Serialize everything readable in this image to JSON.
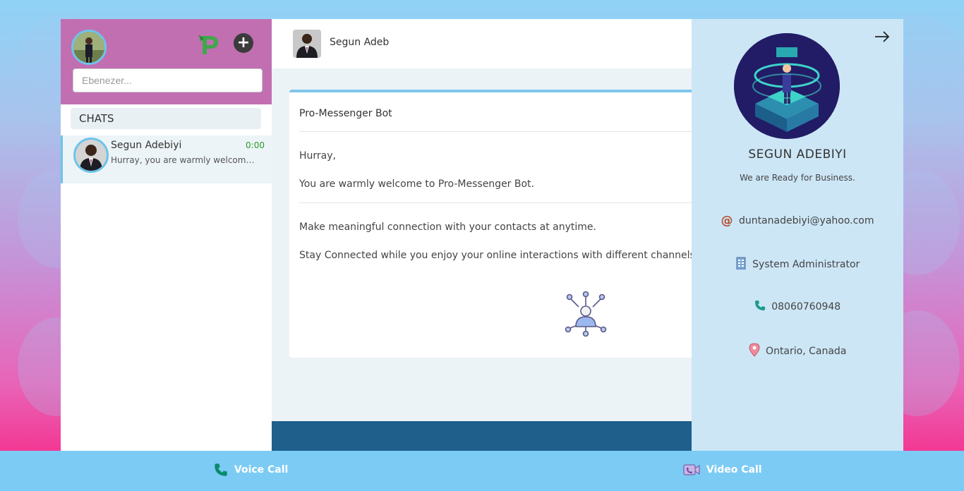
{
  "sidebar": {
    "search_placeholder": "Ebenezer...",
    "chats_label": "CHATS",
    "chats": [
      {
        "name": "Segun Adebiyi",
        "time": "0:00",
        "preview": "Hurray, you are warmly welcome..."
      }
    ]
  },
  "conversation": {
    "contact_name": "Segun Adeb",
    "message_card": {
      "title": "Pro-Messenger Bot",
      "greeting": "Hurray,",
      "welcome": "You are warmly welcome to Pro-Messenger Bot.",
      "line1": "Make meaningful connection with your contacts at anytime.",
      "line2": "Stay Connected while you enjoy your online interactions with different channels"
    }
  },
  "profile": {
    "name": "SEGUN ADEBIYI",
    "status": "We are Ready for Business.",
    "email": "duntanadebiyi@yahoo.com",
    "role": "System Administrator",
    "phone": "08060760948",
    "location": "Ontario, Canada"
  },
  "call_bar": {
    "voice_label": "Voice Call",
    "video_label": "Video Call"
  },
  "colors": {
    "header_purple": "#c16fb1",
    "accent_blue": "#7ccbf4",
    "profile_panel": "#cce6f6",
    "footer_navy": "#1f5f8b"
  },
  "icons": [
    "logo-p-icon",
    "plus-icon",
    "arrow-right-icon",
    "at-icon",
    "building-icon",
    "phone-icon",
    "location-pin-icon",
    "network-user-icon",
    "video-call-icon"
  ]
}
